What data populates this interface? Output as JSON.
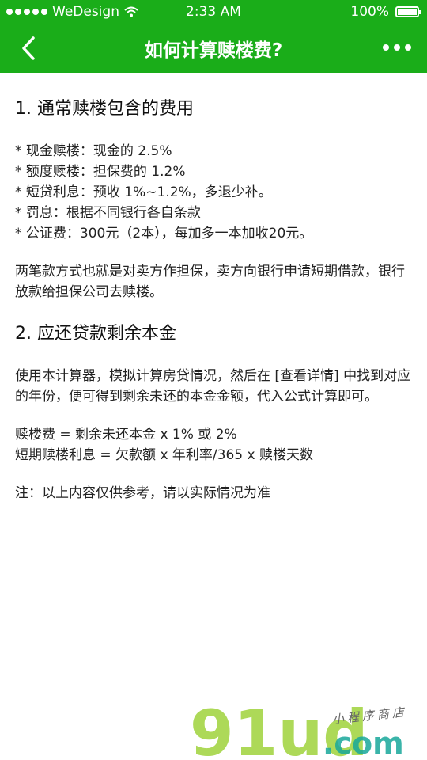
{
  "status_bar": {
    "carrier": "WeDesign",
    "time": "2:33 AM",
    "battery": "100%"
  },
  "nav": {
    "title": "如何计算赎楼费?"
  },
  "sections": [
    {
      "heading": "1. 通常赎楼包含的费用",
      "items": [
        "* 现金赎楼：现金的 2.5%",
        "* 额度赎楼：担保费的 1.2%",
        "* 短贷利息：预收 1%~1.2%，多退少补。",
        "* 罚息：根据不同银行各自条款",
        "* 公证费：300元（2本），每加多一本加收20元。"
      ],
      "paragraph": "两笔款方式也就是对卖方作担保，卖方向银行申请短期借款，银行放款给担保公司去赎楼。"
    },
    {
      "heading": "2. 应还贷款剩余本金",
      "paragraph": "使用本计算器，模拟计算房贷情况，然后在 [查看详情] 中找到对应的年份，便可得到剩余未还的本金金额，代入公式计算即可。",
      "formulas": [
        "赎楼费 = 剩余未还本金 x 1% 或 2%",
        "短期赎楼利息 = 欠款额 x 年利率/365 x 赎楼天数"
      ],
      "note": "注：以上内容仅供参考，请以实际情况为准"
    }
  ],
  "watermark": {
    "logo": "91ud",
    "domain": ".com",
    "tagline": "小程序商店"
  },
  "colors": {
    "header_bg": "#1aad19",
    "header_text": "#ffffff",
    "body_text": "#222222",
    "watermark_green": "#9fd23b",
    "watermark_teal": "#18a79a"
  }
}
